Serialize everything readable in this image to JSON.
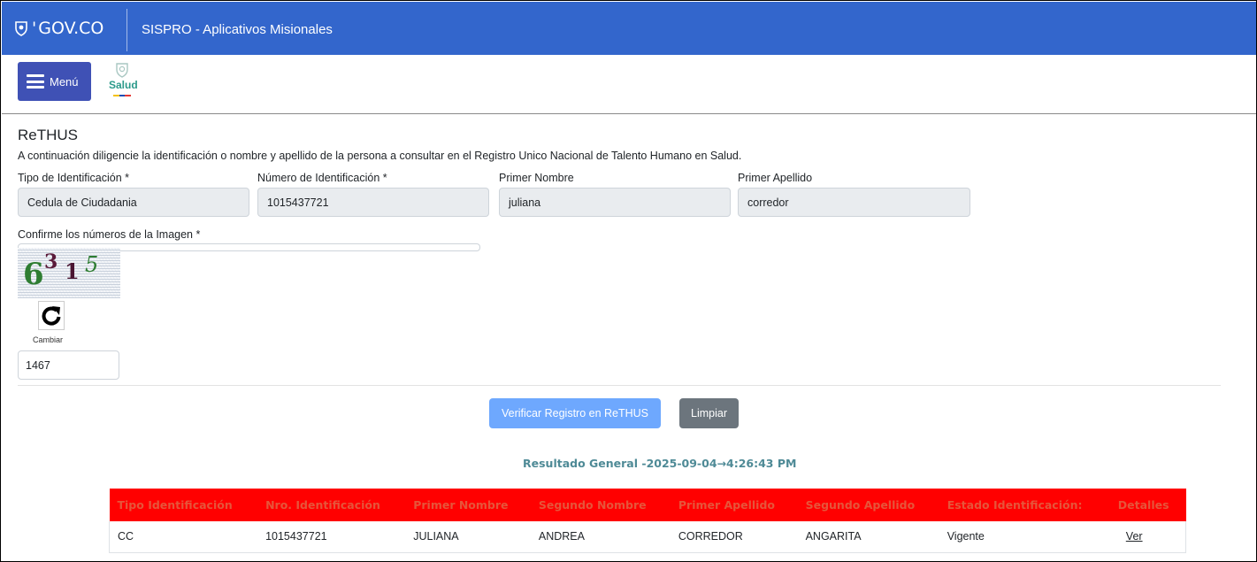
{
  "header": {
    "gov_logo": "GOV.CO",
    "app_title": "SISPRO - Aplicativos Misionales"
  },
  "menu": {
    "button_label": "Menú",
    "salud_logo": "Salud"
  },
  "form": {
    "title": "ReTHUS",
    "intro": "A continuación diligencie la identificación o nombre y apellido de la persona a consultar en el Registro Unico Nacional de Talento Humano en Salud.",
    "fields": [
      {
        "label": "Tipo de Identificación *",
        "value": "Cedula de Ciudadania"
      },
      {
        "label": "Número de Identificación *",
        "value": "1015437721"
      },
      {
        "label": "Primer Nombre",
        "value": "juliana"
      },
      {
        "label": "Primer Apellido",
        "value": "corredor"
      }
    ],
    "captcha_label": "Confirme los números de la Imagen *",
    "captcha_digits": [
      "6",
      "3",
      "1",
      "5"
    ],
    "refresh_label": "Cambiar",
    "captcha_value": "1467",
    "verify_button": "Verificar Registro en ReTHUS",
    "clear_button": "Limpiar"
  },
  "result": {
    "title": "Resultado General -2025-09-04→4:26:43 PM",
    "columns": [
      "Tipo Identificación",
      "Nro. Identificación",
      "Primer Nombre",
      "Segundo Nombre",
      "Primer Apellido",
      "Segundo Apellido",
      "Estado Identificación:",
      "Detalles"
    ],
    "rows": [
      [
        "CC",
        "1015437721",
        "JULIANA",
        "ANDREA",
        "CORREDOR",
        "ANGARITA",
        "Vigente",
        "Ver"
      ]
    ]
  },
  "colors": {
    "gov_bar": "#3366cc",
    "menu_button": "#3f51b5",
    "verify_button": "#6ea8fe",
    "clear_button": "#6c757d",
    "table_header": "#ff0000",
    "result_title": "#4e8a96"
  },
  "icons": {
    "gov_shield": "shield-icon",
    "menu": "hamburger-icon",
    "salud": "salud-logo-icon",
    "refresh": "refresh-icon"
  }
}
